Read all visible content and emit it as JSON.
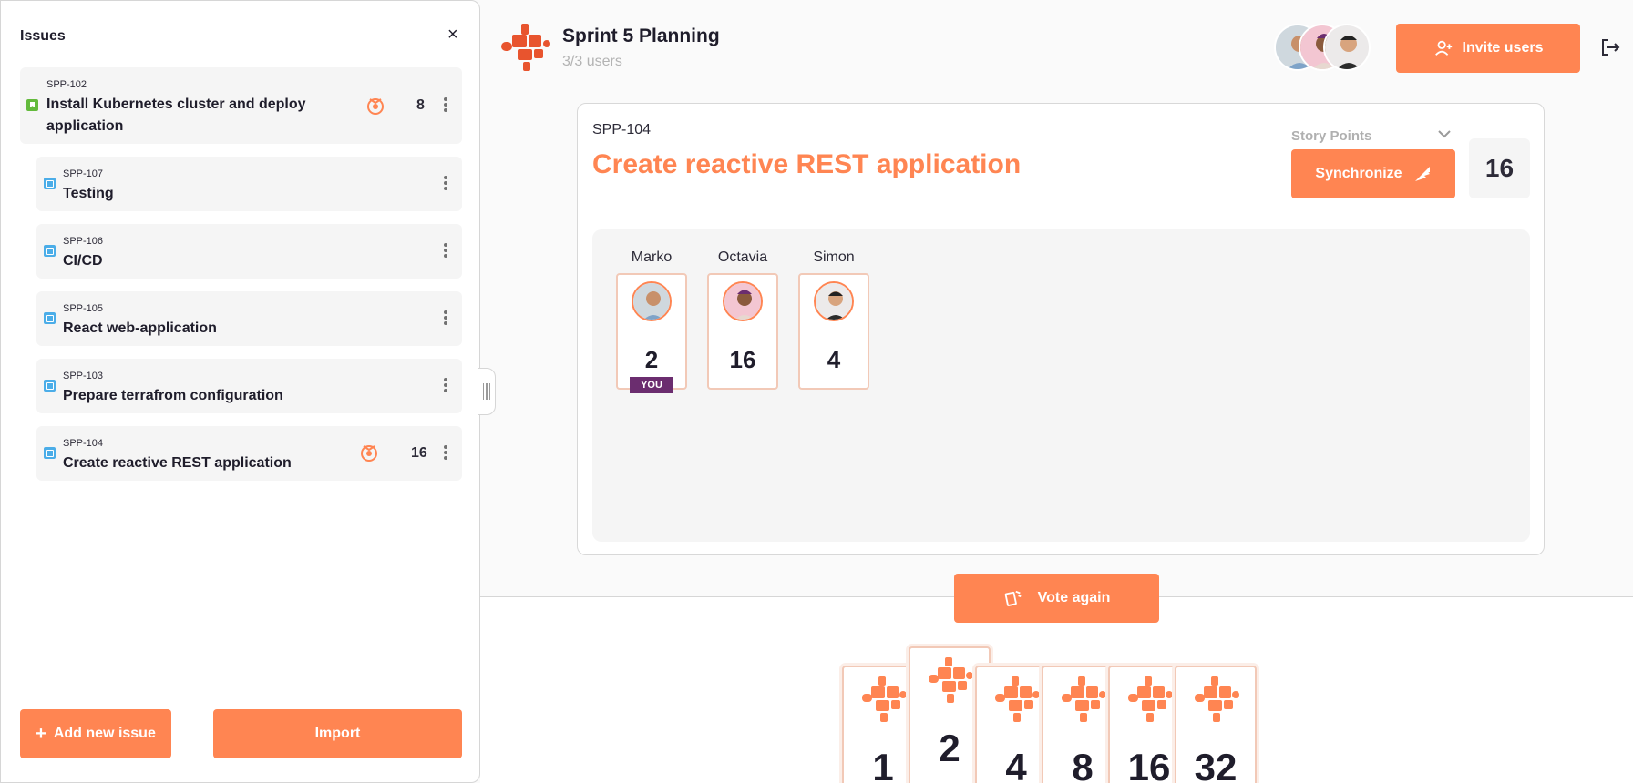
{
  "sidebar": {
    "title": "Issues",
    "close_label": "×",
    "issues": [
      {
        "key": "SPP-102",
        "name_line1": "Install Kubernetes cluster and deploy",
        "name_line2": "application",
        "points": "8",
        "type": "story"
      },
      {
        "key": "SPP-107",
        "name": "Testing",
        "type": "task"
      },
      {
        "key": "SPP-106",
        "name": "CI/CD",
        "type": "task"
      },
      {
        "key": "SPP-105",
        "name": "React web-application",
        "type": "task"
      },
      {
        "key": "SPP-103",
        "name": "Prepare terrafrom configuration",
        "type": "task"
      },
      {
        "key": "SPP-104",
        "name": "Create reactive REST application",
        "points": "16",
        "type": "task"
      }
    ],
    "add_button": "Add new issue",
    "add_button_icon": "+",
    "import_button": "Import"
  },
  "header": {
    "room_title": "Sprint 5 Planning",
    "users_count": "3/3 users",
    "invite_button": "Invite users"
  },
  "current_issue": {
    "key": "SPP-104",
    "name": "Create reactive REST application",
    "field_label": "Story Points",
    "sync_button": "Synchronize",
    "estimate": "16"
  },
  "votes": [
    {
      "name": "Marko",
      "value": "2",
      "badge": "YOU"
    },
    {
      "name": "Octavia",
      "value": "16"
    },
    {
      "name": "Simon",
      "value": "4"
    }
  ],
  "vote_again_button": "Vote again",
  "deck": [
    "1",
    "2",
    "4",
    "8",
    "16",
    "32"
  ],
  "colors": {
    "accent": "#ff8552",
    "brand": "#e8542e",
    "you_badge": "#6b2d6f",
    "story_icon": "#63ba3c",
    "task_icon": "#4bade8"
  }
}
